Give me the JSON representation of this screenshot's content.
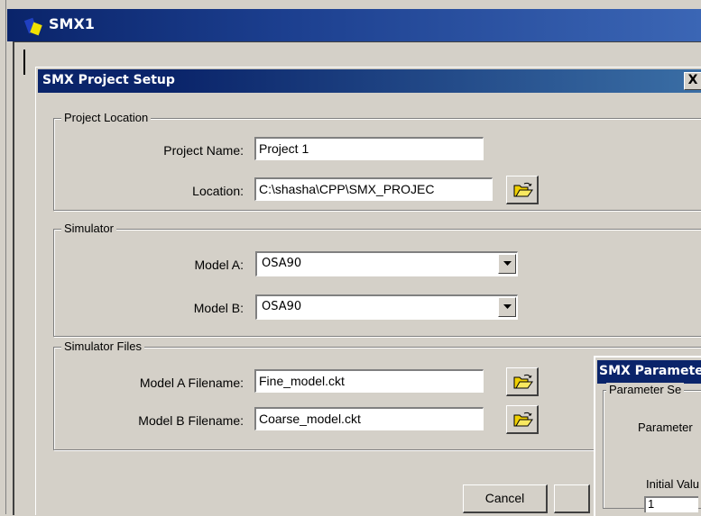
{
  "app": {
    "title": "SMX1"
  },
  "setup_dialog": {
    "title": "SMX Project Setup",
    "close_label": "X",
    "project_location": {
      "group_label": "Project Location",
      "project_name_label": "Project Name:",
      "project_name_value": "Project 1",
      "location_label": "Location:",
      "location_value": "C:\\shasha\\CPP\\SMX_PROJEC"
    },
    "simulator": {
      "group_label": "Simulator",
      "model_a_label": "Model A:",
      "model_a_value": "OSA90",
      "model_b_label": "Model B:",
      "model_b_value": "OSA90"
    },
    "simulator_files": {
      "group_label": "Simulator Files",
      "model_a_filename_label": "Model A Filename:",
      "model_a_filename_value": "Fine_model.ckt",
      "model_b_filename_label": "Model B Filename:",
      "model_b_filename_value": "Coarse_model.ckt"
    },
    "cancel_label": "Cancel"
  },
  "parameter_dialog": {
    "title": "SMX Paramete",
    "group_label": "Parameter Se",
    "parameter_label": "Parameter",
    "initial_value_label": "Initial Valu",
    "initial_value": "1"
  },
  "icons": {
    "app_icon": "app-icon",
    "folder_icon": "open-folder-icon",
    "dropdown_icon": "chevron-down-icon",
    "close_icon": "close-icon"
  },
  "colors": {
    "title_bar": "#0a246a",
    "window_face": "#d4d0c8",
    "folder_yellow": "#f0d000"
  }
}
